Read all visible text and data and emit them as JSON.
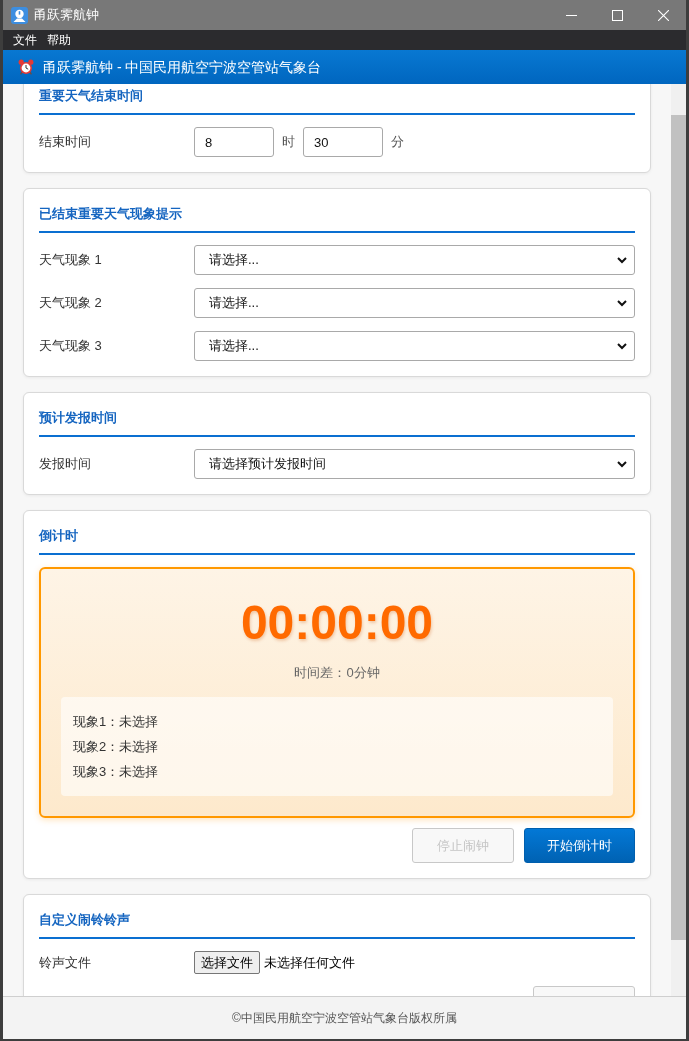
{
  "window": {
    "title": "甬跃霁航钟"
  },
  "menu": [
    {
      "label": "文件"
    },
    {
      "label": "帮助"
    }
  ],
  "header": {
    "title": "甬跃霁航钟 - 中国民用航空宁波空管站气象台"
  },
  "sections": [
    {
      "kind": "time",
      "title": "重要天气结束时间",
      "label": "结束时间",
      "fields": [
        {
          "value": "8",
          "unit": "时"
        },
        {
          "value": "30",
          "unit": "分"
        }
      ]
    },
    {
      "kind": "selects",
      "title": "已结束重要天气现象提示",
      "rows": [
        {
          "label": "天气现象 1",
          "value": "请选择..."
        },
        {
          "label": "天气现象 2",
          "value": "请选择..."
        },
        {
          "label": "天气现象 3",
          "value": "请选择..."
        }
      ]
    },
    {
      "kind": "selects",
      "title": "预计发报时间",
      "rows": [
        {
          "label": "发报时间",
          "value": "请选择预计发报时间"
        }
      ]
    },
    {
      "kind": "countdown",
      "title": "倒计时",
      "time": "00:00:00",
      "difference": "时间差：0分钟",
      "phenomena": [
        "现象1：未选择",
        "现象2：未选择",
        "现象3：未选择"
      ],
      "buttons": [
        {
          "label": "停止闹钟",
          "kind": "secondary",
          "disabled": true
        },
        {
          "label": "开始倒计时",
          "kind": "primary",
          "disabled": false
        }
      ]
    },
    {
      "kind": "file",
      "title": "自定义闹铃铃声",
      "label": "铃声文件",
      "button": "选择文件",
      "status": "未选择任何文件"
    }
  ],
  "footer": {
    "text": "©中国民用航空宁波空管站气象台版权所属"
  }
}
